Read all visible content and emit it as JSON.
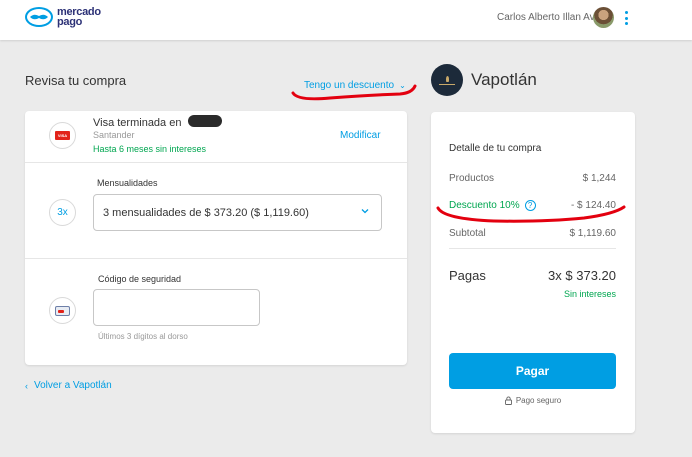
{
  "header": {
    "brand_line1": "mercado",
    "brand_line2": "pago",
    "user_name": "Carlos Alberto Illan Avalos",
    "accent": "#009ee3"
  },
  "left": {
    "title": "Revisa tu compra",
    "discount_link": "Tengo un descuento",
    "card": {
      "badge": "VISA",
      "title": "Visa terminada en",
      "bank": "Santander",
      "months": "Hasta 6 meses sin intereses",
      "modify": "Modificar"
    },
    "installments": {
      "badge": "3x",
      "label": "Mensualidades",
      "selected": "3 mensualidades de $ 373.20 ($ 1,119.60)"
    },
    "security": {
      "label": "Código de seguridad",
      "value": "",
      "hint": "Últimos 3 dígitos al dorso"
    },
    "back": "Volver a Vapotlán"
  },
  "right": {
    "store_name": "Vapotlán",
    "detail_title": "Detalle de tu compra",
    "products_label": "Productos",
    "products_value": "$ 1,244",
    "discount_label": "Descuento 10%",
    "discount_value": "- $ 124.40",
    "subtotal_label": "Subtotal",
    "subtotal_value": "$ 1,119.60",
    "pay_label": "Pagas",
    "pay_value": "3x $ 373.20",
    "no_interest": "Sin intereses",
    "pay_button": "Pagar",
    "secure": "Pago seguro"
  },
  "colors": {
    "accent": "#009ee3",
    "success": "#00a650",
    "annotation": "#e3000f"
  }
}
